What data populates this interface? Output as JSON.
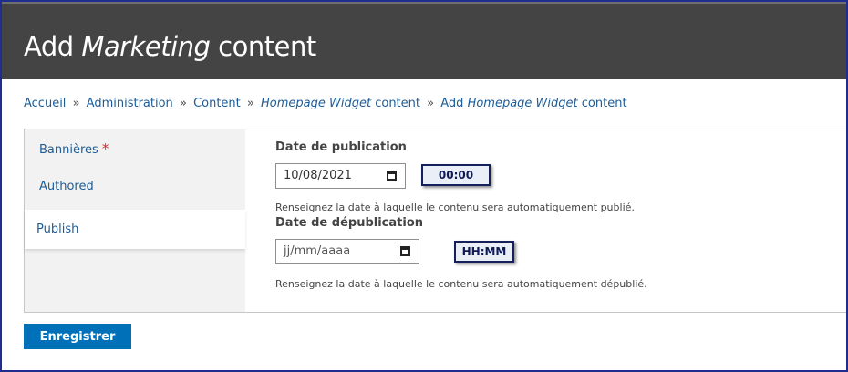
{
  "header": {
    "title_prefix": "Add",
    "title_italic": "Marketing",
    "title_suffix": "content"
  },
  "breadcrumb": {
    "items": [
      {
        "label": "Accueil"
      },
      {
        "label": "Administration"
      },
      {
        "label": "Content"
      },
      {
        "label_italic": "Homepage Widget",
        "label": "content"
      },
      {
        "label_prefix": "Add",
        "label_italic": "Homepage Widget",
        "label": "content"
      }
    ],
    "separator": "»"
  },
  "tabs": [
    {
      "label": "Bannières",
      "required_mark": "*"
    },
    {
      "label": "Authored"
    },
    {
      "label": "Publish"
    }
  ],
  "publish": {
    "publish_date": {
      "label": "Date de publication",
      "value": "10/08/2021",
      "time": "00:00",
      "description": "Renseignez la date à laquelle le contenu sera automatiquement publié."
    },
    "unpublish_date": {
      "label": "Date de dépublication",
      "placeholder": "jj/mm/aaaa",
      "time": "HH:MM",
      "description": "Renseignez la date à laquelle le contenu sera automatiquement dépublié."
    }
  },
  "actions": {
    "save_label": "Enregistrer"
  },
  "colors": {
    "header_bg": "#444444",
    "link": "#1d5c97",
    "primary_button": "#0071b8",
    "required": "#e0222a",
    "frame_border": "#1f2d8f"
  }
}
